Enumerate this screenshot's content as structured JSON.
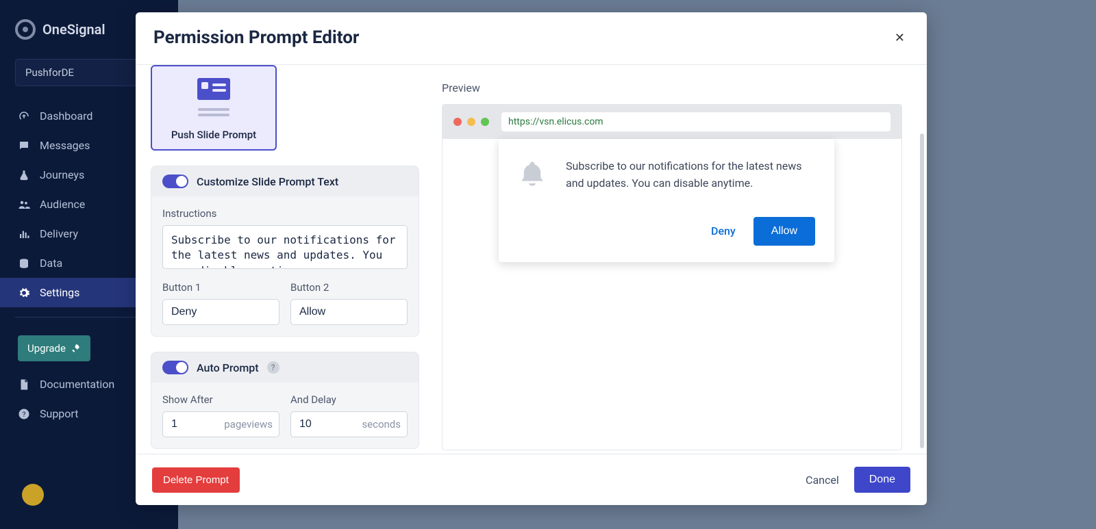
{
  "brand": "OneSignal",
  "app_name": "PushforDE",
  "sidebar": {
    "items": [
      {
        "label": "Dashboard"
      },
      {
        "label": "Messages"
      },
      {
        "label": "Journeys"
      },
      {
        "label": "Audience"
      },
      {
        "label": "Delivery"
      },
      {
        "label": "Data"
      },
      {
        "label": "Settings"
      }
    ],
    "upgrade_label": "Upgrade",
    "doc_label": "Documentation",
    "support_label": "Support"
  },
  "modal": {
    "title": "Permission Prompt Editor",
    "type_card_label": "Push Slide Prompt",
    "customize_title": "Customize Slide Prompt Text",
    "instructions_label": "Instructions",
    "instructions_value": "Subscribe to our notifications for the latest news and updates. You can disable anytime.",
    "button1_label": "Button 1",
    "button1_value": "Deny",
    "button2_label": "Button 2",
    "button2_value": "Allow",
    "auto_prompt_title": "Auto Prompt",
    "show_after_label": "Show After",
    "show_after_value": "1",
    "show_after_unit": "pageviews",
    "and_delay_label": "And Delay",
    "and_delay_value": "10",
    "and_delay_unit": "seconds",
    "preview_label": "Preview",
    "preview_url": "https://vsn.elicus.com",
    "preview_message": "Subscribe to our notifications for the latest news and updates. You can disable anytime.",
    "preview_deny": "Deny",
    "preview_allow": "Allow",
    "delete_label": "Delete Prompt",
    "cancel_label": "Cancel",
    "done_label": "Done"
  }
}
